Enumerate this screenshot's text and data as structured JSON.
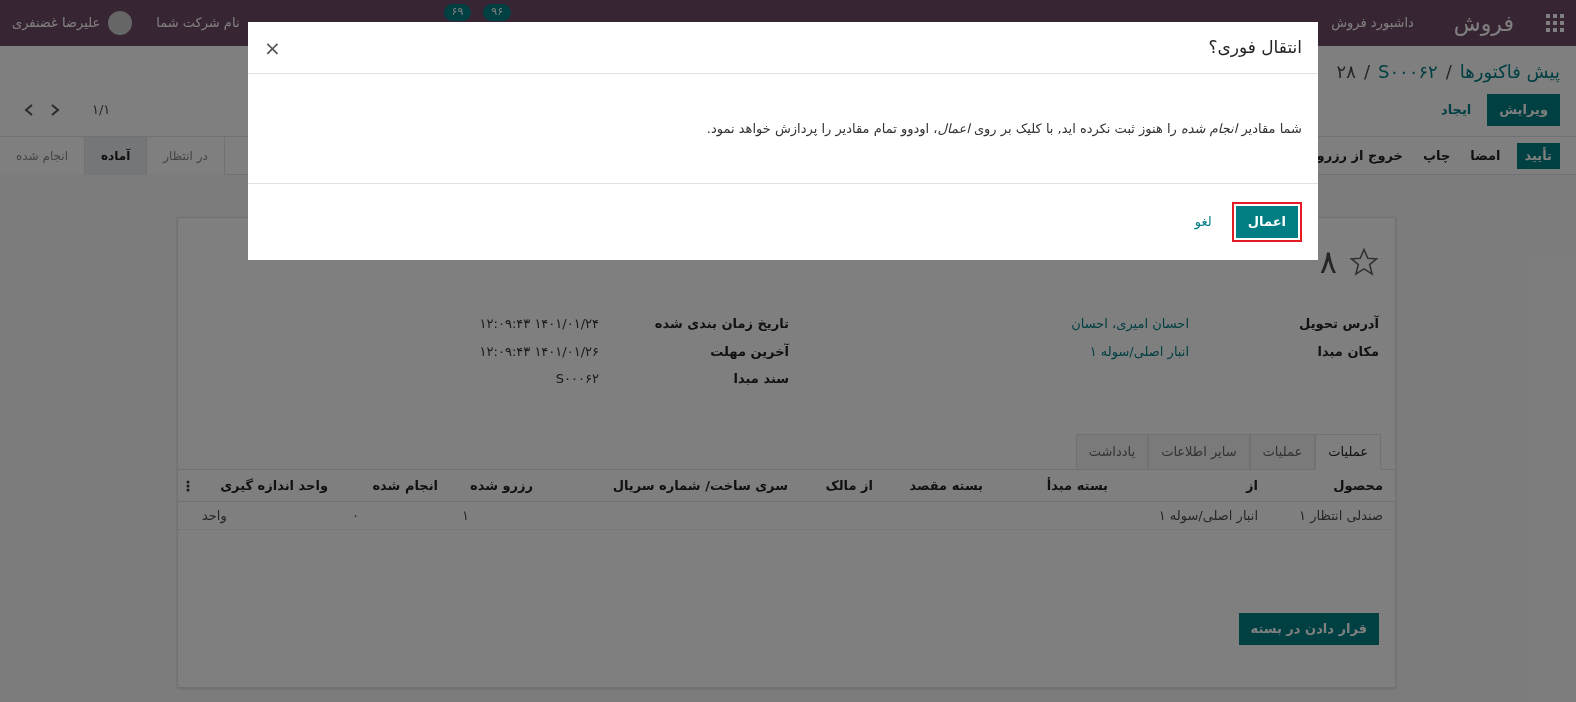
{
  "navbar": {
    "app_name": "فروش",
    "menu": [
      "داشبورد فروش"
    ],
    "badges": [
      "۹۶",
      "۶۹"
    ],
    "company": "نام شرکت شما",
    "user": "علیرضا غضنفری"
  },
  "breadcrumb": [
    "پیش فاکتورها",
    "S۰۰۰۶۲",
    "۲۸"
  ],
  "breadcrumb_separator": "/",
  "actions": [
    {
      "label": "ویرایش",
      "primary": true
    },
    {
      "label": "ایجاد",
      "primary": false
    }
  ],
  "pager": "۱/۱",
  "header_buttons": [
    {
      "label": "تأیید",
      "primary": true
    },
    {
      "label": "امضا",
      "primary": false
    },
    {
      "label": "چاپ",
      "primary": false
    },
    {
      "label": "خروج از رزرو",
      "primary": false
    }
  ],
  "statusbar": [
    {
      "label": "در انتظار",
      "selected": false
    },
    {
      "label": "آماده",
      "selected": true
    },
    {
      "label": "انجام شده",
      "selected": false
    }
  ],
  "record_title": "۸",
  "fields_right": [
    {
      "label": "آدرس تحویل",
      "value": "احسان امیری، احسان",
      "link": true
    },
    {
      "label": "مکان مبدا",
      "value": "انبار اصلی/سوله ۱",
      "link": true
    }
  ],
  "fields_left": [
    {
      "label": "تاریخ زمان بندی شده",
      "value": "۱۴۰۱/۰۱/۲۴ ۱۲:۰۹:۴۳"
    },
    {
      "label": "آخرین مهلت",
      "value": "۱۴۰۱/۰۱/۲۶ ۱۲:۰۹:۴۳"
    },
    {
      "label": "سند مبدا",
      "value": "S۰۰۰۶۲"
    }
  ],
  "tabs": [
    {
      "label": "عملیات",
      "selected": true
    },
    {
      "label": "عملیات",
      "selected": false
    },
    {
      "label": "سایر اطلاعات",
      "selected": false
    },
    {
      "label": "یادداشت",
      "selected": false
    }
  ],
  "table": {
    "columns": [
      "محصول",
      "از",
      "بسته مبدأ",
      "بسته مقصد",
      "از مالک",
      "سری ساخت/ شماره سریال",
      "رزرو شده",
      "انجام شده",
      "واحد اندازه گیری"
    ],
    "rows": [
      [
        "صندلی انتظار ۱",
        "انبار اصلی/سوله ۱",
        "",
        "",
        "",
        "",
        "۱",
        "۰",
        "واحد"
      ]
    ]
  },
  "put_in_pack": "قرار دادن در بسته",
  "dialog": {
    "title": "انتقال فوری؟",
    "close": "×",
    "message": "شما مقادیر *انجام شده* را هنوز ثبت نکرده اید, با کلیک بر روی *اعمال*، اودوو تمام مقادیر را پردازش خواهد نمود.",
    "buttons": [
      {
        "label": "اعمال",
        "primary": true,
        "highlighted": true
      },
      {
        "label": "لغو",
        "primary": false,
        "highlighted": false
      }
    ]
  }
}
